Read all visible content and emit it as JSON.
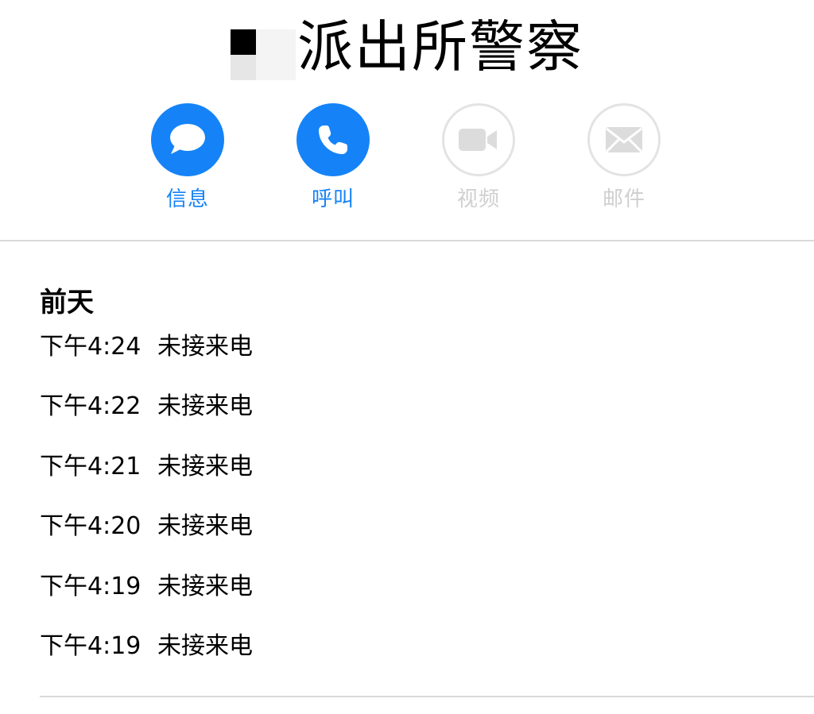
{
  "contact": {
    "name": "派出所警察"
  },
  "actions": [
    {
      "key": "message",
      "label": "信息",
      "icon": "message-bubble-icon",
      "enabled": true
    },
    {
      "key": "call",
      "label": "呼叫",
      "icon": "phone-icon",
      "enabled": true
    },
    {
      "key": "video",
      "label": "视频",
      "icon": "video-camera-icon",
      "enabled": false
    },
    {
      "key": "mail",
      "label": "邮件",
      "icon": "envelope-icon",
      "enabled": false
    }
  ],
  "colors": {
    "accent": "#1583f7",
    "disabled": "#cfcfcf",
    "divider": "#d9d9d9"
  },
  "history": {
    "day_heading": "前天",
    "calls": [
      {
        "time": "下午4:24",
        "status": "未接来电"
      },
      {
        "time": "下午4:22",
        "status": "未接来电"
      },
      {
        "time": "下午4:21",
        "status": "未接来电"
      },
      {
        "time": "下午4:20",
        "status": "未接来电"
      },
      {
        "time": "下午4:19",
        "status": "未接来电"
      },
      {
        "time": "下午4:19",
        "status": "未接来电"
      }
    ]
  }
}
